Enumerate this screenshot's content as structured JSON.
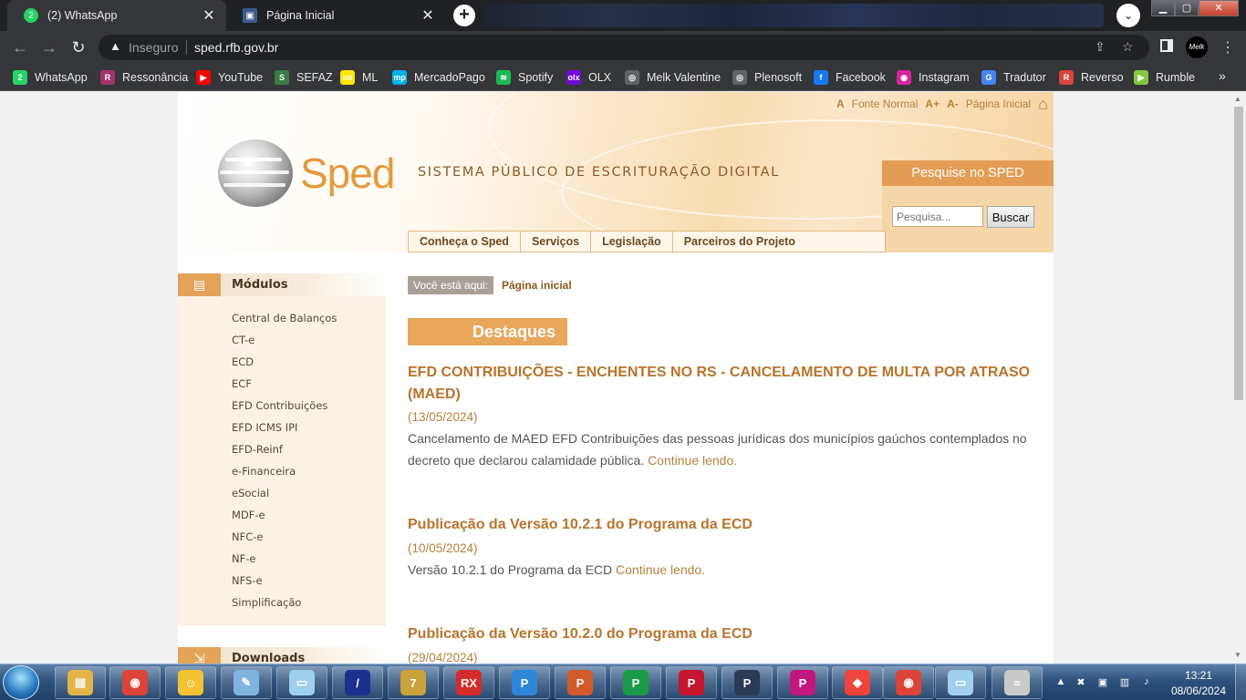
{
  "browser": {
    "tabs": [
      {
        "title": "(2) WhatsApp",
        "active": true,
        "favicon": "whatsapp-icon"
      },
      {
        "title": "Página Inicial",
        "active": false,
        "favicon": "gov-icon"
      }
    ],
    "close_glyph": "✕",
    "new_tab_glyph": "+",
    "window_buttons": {
      "minimize": "▁",
      "maximize": "▢",
      "close": "✕"
    },
    "address": {
      "security_label": "Inseguro",
      "url": "sped.rfb.gov.br"
    },
    "profile_label": "Melk",
    "bookmarks": [
      {
        "label": "WhatsApp",
        "icon": "whatsapp-icon",
        "color": "#25d366",
        "glyph": "2"
      },
      {
        "label": "Ressonância",
        "icon": "resonance-icon",
        "color": "#a2346b",
        "glyph": "R"
      },
      {
        "label": "YouTube",
        "icon": "youtube-icon",
        "color": "#ff0000",
        "glyph": "▶"
      },
      {
        "label": "SEFAZ",
        "icon": "sefaz-icon",
        "color": "#3a7d44",
        "glyph": "S"
      },
      {
        "label": "ML",
        "icon": "mercadolivre-icon",
        "color": "#ffe600",
        "glyph": "ml"
      },
      {
        "label": "MercadoPago",
        "icon": "mercadopago-icon",
        "color": "#00b1ea",
        "glyph": "mp"
      },
      {
        "label": "Spotify",
        "icon": "spotify-icon",
        "color": "#1db954",
        "glyph": "≋"
      },
      {
        "label": "OLX",
        "icon": "olx-icon",
        "color": "#6e0ad6",
        "glyph": "olx"
      },
      {
        "label": "Melk Valentine",
        "icon": "globe-icon",
        "color": "#5f6368",
        "glyph": "◎"
      },
      {
        "label": "Plenosoft",
        "icon": "globe-icon",
        "color": "#5f6368",
        "glyph": "◎"
      },
      {
        "label": "Facebook",
        "icon": "facebook-icon",
        "color": "#1877f2",
        "glyph": "f"
      },
      {
        "label": "Instagram",
        "icon": "instagram-icon",
        "color": "#d6249f",
        "glyph": "◉"
      },
      {
        "label": "Tradutor",
        "icon": "translate-icon",
        "color": "#4285f4",
        "glyph": "G"
      },
      {
        "label": "Reverso",
        "icon": "reverso-icon",
        "color": "#d8433c",
        "glyph": "R"
      },
      {
        "label": "Rumble",
        "icon": "rumble-icon",
        "color": "#85c742",
        "glyph": "▶"
      }
    ],
    "more_bookmarks_glyph": "»"
  },
  "site": {
    "logo_word": "Sped",
    "tagline": "SISTEMA PÚBLICO DE ESCRITURAÇÃO DIGITAL",
    "accessibility": {
      "font_normal_icon": "A",
      "font_normal": "Fonte Normal",
      "increase": "A+",
      "decrease": "A-",
      "home": "Página Inicial"
    },
    "search": {
      "title": "Pesquise no SPED",
      "placeholder": "Pesquisa...",
      "button": "Buscar"
    },
    "nav": [
      "Conheça o Sped",
      "Serviços",
      "Legislação",
      "Parceiros do Projeto"
    ],
    "sidebar": {
      "modules_title": "Módulos",
      "modules": [
        "Central de Balanços",
        "CT-e",
        "ECD",
        "ECF",
        "EFD Contribuições",
        "EFD ICMS IPI",
        "EFD-Reinf",
        "e-Financeira",
        "eSocial",
        "MDF-e",
        "NFC-e",
        "NF-e",
        "NFS-e",
        "Simplificação"
      ],
      "downloads_title": "Downloads"
    },
    "breadcrumb": {
      "label": "Você está aqui:",
      "current": "Página inicial"
    },
    "highlights_title": "Destaques",
    "news": [
      {
        "title": "EFD CONTRIBUIÇÕES - ENCHENTES NO RS - CANCELAMENTO DE MULTA POR ATRASO (MAED)",
        "date": "(13/05/2024)",
        "summary": "Cancelamento de MAED EFD Contribuições das pessoas jurídicas dos municípios gaúchos contemplados no decreto que declarou calamidade pública. ",
        "more": "Continue lendo."
      },
      {
        "title": "Publicação da Versão 10.2.1 do Programa da ECD",
        "date": "(10/05/2024)",
        "summary": "Versão 10.2.1 do Programa da ECD ",
        "more": "Continue lendo."
      },
      {
        "title": "Publicação da Versão 10.2.0 do Programa da ECD",
        "date": "(29/04/2024)"
      }
    ]
  },
  "taskbar": {
    "apps": [
      {
        "name": "explorer",
        "color": "#e3b449",
        "glyph": "▤"
      },
      {
        "name": "chrome",
        "color": "#db4437",
        "glyph": "◉"
      },
      {
        "name": "app-yellow",
        "color": "#f1c232",
        "glyph": "☺"
      },
      {
        "name": "paint",
        "color": "#7fb3e0",
        "glyph": "✎"
      },
      {
        "name": "notepad",
        "color": "#9fd0ee",
        "glyph": "▭"
      },
      {
        "name": "app-blue-slash",
        "color": "#1b2f8f",
        "glyph": "/"
      },
      {
        "name": "app-7",
        "color": "#c9a23b",
        "glyph": "7"
      },
      {
        "name": "app-rx",
        "color": "#d52b2b",
        "glyph": "RX"
      },
      {
        "name": "app-p-blue",
        "color": "#2e86d8",
        "glyph": "P"
      },
      {
        "name": "app-p-orange",
        "color": "#d2592a",
        "glyph": "P"
      },
      {
        "name": "app-p-green",
        "color": "#1b9a47",
        "glyph": "P"
      },
      {
        "name": "app-p-red",
        "color": "#c7162f",
        "glyph": "P"
      },
      {
        "name": "app-p-dark",
        "color": "#2b3a55",
        "glyph": "P"
      },
      {
        "name": "app-p-pink",
        "color": "#c2177d",
        "glyph": "P"
      },
      {
        "name": "anydesk",
        "color": "#ef443b",
        "glyph": "◆"
      },
      {
        "name": "chrome-profile",
        "color": "#db4437",
        "glyph": "◉"
      },
      {
        "name": "notepad-2",
        "color": "#9fd0ee",
        "glyph": "▭"
      },
      {
        "name": "app-faded",
        "color": "#c9c9c9",
        "glyph": "≈"
      }
    ],
    "clock_time": "13:21",
    "clock_date": "08/06/2024"
  }
}
